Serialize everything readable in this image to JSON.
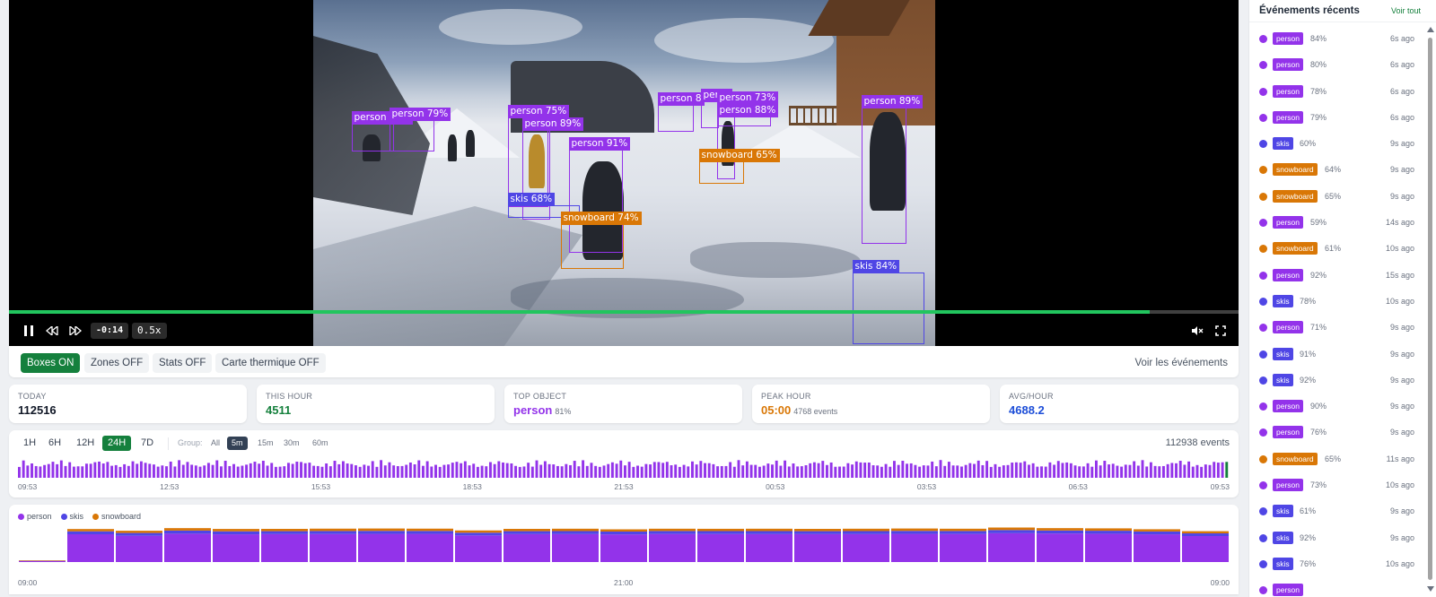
{
  "colors": {
    "person": "#9333ea",
    "skis": "#4f46e5",
    "snowboard": "#d97706",
    "accent": "#15803d",
    "progress": "#22c55e"
  },
  "video": {
    "time_remaining": "-0:14",
    "playback_rate": "0.5x",
    "progress_fraction": 0.928,
    "controls": [
      "pause-icon",
      "rewind-icon",
      "fast-forward-icon",
      "volume-mute-icon",
      "fullscreen-icon"
    ],
    "detections": [
      {
        "label": "person 68%",
        "cls": "person"
      },
      {
        "label": "person 79%",
        "cls": "person"
      },
      {
        "label": "person 75%",
        "cls": "person"
      },
      {
        "label": "person 89%",
        "cls": "person"
      },
      {
        "label": "person 91%",
        "cls": "person"
      },
      {
        "label": "person 8",
        "cls": "person"
      },
      {
        "label": "perso",
        "cls": "person"
      },
      {
        "label": "person 73%",
        "cls": "person"
      },
      {
        "label": "person 88%",
        "cls": "person"
      },
      {
        "label": "person 89%",
        "cls": "person"
      },
      {
        "label": "snowboard 65%",
        "cls": "snowboard"
      },
      {
        "label": "skis 68%",
        "cls": "skis"
      },
      {
        "label": "snowboard 74%",
        "cls": "snowboard"
      },
      {
        "label": "skis 84%",
        "cls": "skis"
      }
    ]
  },
  "toolbar": {
    "boxes": "Boxes ON",
    "zones": "Zones OFF",
    "stats": "Stats OFF",
    "heatmap": "Carte thermique OFF",
    "events_link": "Voir les événements"
  },
  "stats": {
    "today": {
      "label": "TODAY",
      "value": "112516"
    },
    "this_hour": {
      "label": "THIS HOUR",
      "value": "4511"
    },
    "top_object": {
      "label": "TOP OBJECT",
      "value": "person",
      "sub": "81%"
    },
    "peak_hour": {
      "label": "PEAK HOUR",
      "value": "05:00",
      "sub": "4768 events"
    },
    "avg_hour": {
      "label": "AVG/HOUR",
      "value": "4688.2"
    }
  },
  "timeline": {
    "ranges": [
      "1H",
      "6H",
      "12H",
      "24H",
      "7D"
    ],
    "active_range": "24H",
    "group_label": "Group:",
    "groups": [
      "All",
      "5m",
      "15m",
      "30m",
      "60m"
    ],
    "active_group": "5m",
    "total": "112938 events",
    "ticks": [
      "09:53",
      "12:53",
      "15:53",
      "18:53",
      "21:53",
      "00:53",
      "03:53",
      "06:53",
      "09:53"
    ]
  },
  "stacked": {
    "legend": [
      "person",
      "skis",
      "snowboard"
    ],
    "ticks": [
      "09:00",
      "21:00",
      "09:00"
    ]
  },
  "chart_data": {
    "type": "bar",
    "stacked": true,
    "categories": [
      "09:00",
      "10:00",
      "11:00",
      "12:00",
      "13:00",
      "14:00",
      "15:00",
      "16:00",
      "17:00",
      "18:00",
      "19:00",
      "20:00",
      "21:00",
      "22:00",
      "23:00",
      "00:00",
      "01:00",
      "02:00",
      "03:00",
      "04:00",
      "05:00",
      "06:00",
      "07:00",
      "08:00",
      "09:00"
    ],
    "series": [
      {
        "name": "person",
        "values": [
          190,
          3720,
          3520,
          3800,
          3710,
          3740,
          3750,
          3770,
          3770,
          3560,
          3740,
          3740,
          3700,
          3760,
          3750,
          3740,
          3740,
          3740,
          3770,
          3760,
          3860,
          3820,
          3790,
          3710,
          3480
        ]
      },
      {
        "name": "skis",
        "values": [
          8,
          390,
          370,
          410,
          400,
          390,
          400,
          400,
          390,
          370,
          390,
          400,
          380,
          390,
          390,
          400,
          390,
          400,
          400,
          390,
          420,
          400,
          400,
          380,
          360
        ]
      },
      {
        "name": "snowboard",
        "values": [
          2,
          310,
          300,
          330,
          320,
          310,
          320,
          320,
          310,
          300,
          310,
          320,
          300,
          310,
          310,
          320,
          310,
          320,
          320,
          310,
          340,
          320,
          320,
          300,
          290
        ]
      }
    ],
    "ylim": [
      0,
      4800
    ],
    "xlabel": "",
    "ylabel": "",
    "legend_position": "top-left",
    "grid": false
  },
  "recent": {
    "title": "Événements récents",
    "link": "Voir tout",
    "items": [
      {
        "cls": "person",
        "pct": "84%",
        "time": "6s ago"
      },
      {
        "cls": "person",
        "pct": "80%",
        "time": "6s ago"
      },
      {
        "cls": "person",
        "pct": "78%",
        "time": "6s ago"
      },
      {
        "cls": "person",
        "pct": "79%",
        "time": "6s ago"
      },
      {
        "cls": "skis",
        "pct": "60%",
        "time": "9s ago"
      },
      {
        "cls": "snowboard",
        "pct": "64%",
        "time": "9s ago"
      },
      {
        "cls": "snowboard",
        "pct": "65%",
        "time": "9s ago"
      },
      {
        "cls": "person",
        "pct": "59%",
        "time": "14s ago"
      },
      {
        "cls": "snowboard",
        "pct": "61%",
        "time": "10s ago"
      },
      {
        "cls": "person",
        "pct": "92%",
        "time": "15s ago"
      },
      {
        "cls": "skis",
        "pct": "78%",
        "time": "10s ago"
      },
      {
        "cls": "person",
        "pct": "71%",
        "time": "9s ago"
      },
      {
        "cls": "skis",
        "pct": "91%",
        "time": "9s ago"
      },
      {
        "cls": "skis",
        "pct": "92%",
        "time": "9s ago"
      },
      {
        "cls": "person",
        "pct": "90%",
        "time": "9s ago"
      },
      {
        "cls": "person",
        "pct": "76%",
        "time": "9s ago"
      },
      {
        "cls": "snowboard",
        "pct": "65%",
        "time": "11s ago"
      },
      {
        "cls": "person",
        "pct": "73%",
        "time": "10s ago"
      },
      {
        "cls": "skis",
        "pct": "61%",
        "time": "9s ago"
      },
      {
        "cls": "skis",
        "pct": "92%",
        "time": "9s ago"
      },
      {
        "cls": "skis",
        "pct": "76%",
        "time": "10s ago"
      },
      {
        "cls": "person",
        "pct": "",
        "time": ""
      }
    ]
  }
}
